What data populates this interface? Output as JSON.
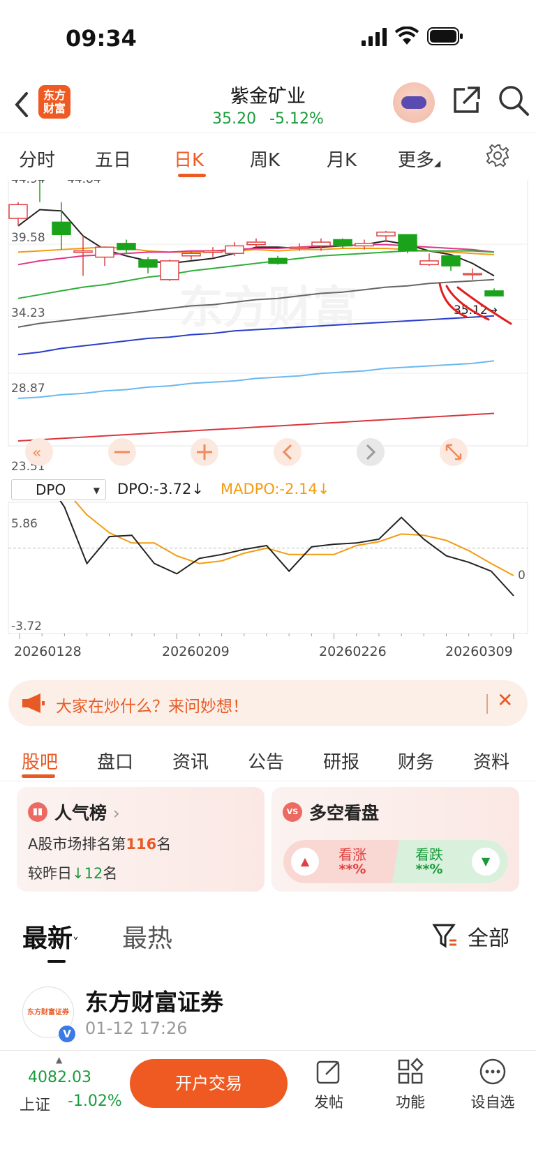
{
  "status": {
    "time": "09:34"
  },
  "header": {
    "logo_text_1": "东方",
    "logo_text_2": "财富",
    "stock_name": "紫金矿业",
    "price": "35.20",
    "change_pct": "-5.12%"
  },
  "tabs": [
    "分时",
    "五日",
    "日K",
    "周K",
    "月K",
    "更多"
  ],
  "active_tab": "日K",
  "kchart": {
    "y_labels": [
      "44.94",
      "44.84",
      "39.58",
      "34.23",
      "28.87",
      "23.51"
    ],
    "price_marker": "35.12→",
    "watermark": "东方财富",
    "toolbar_buttons": [
      "fast-back",
      "zoom-out",
      "zoom-in",
      "prev",
      "next",
      "fullscreen"
    ]
  },
  "indicator": {
    "selected": "DPO",
    "dpo_label": "DPO:-3.72↓",
    "madpo_label": "MADPO:-2.14↓",
    "y_top": "5.86",
    "y_zero": "0",
    "y_bottom": "-3.72",
    "dates": [
      "20260128",
      "20260209",
      "20260226",
      "20260309"
    ]
  },
  "chart_data": [
    {
      "type": "candlestick",
      "title": "",
      "ylim": [
        23.51,
        44.94
      ],
      "candles": [
        {
          "o": 41.2,
          "c": 42.3,
          "h": 42.5,
          "l": 40.6
        },
        {
          "o": 45.1,
          "c": 44.9,
          "h": 45.6,
          "l": 42.5
        },
        {
          "o": 40.9,
          "c": 39.9,
          "h": 42.5,
          "l": 38.7
        },
        {
          "o": 38.6,
          "c": 38.6,
          "h": 39.8,
          "l": 36.6
        },
        {
          "o": 38.1,
          "c": 38.9,
          "h": 38.9,
          "l": 37.4
        },
        {
          "o": 39.2,
          "c": 38.7,
          "h": 39.5,
          "l": 38.4
        },
        {
          "o": 37.9,
          "c": 37.3,
          "h": 38.1,
          "l": 36.8
        },
        {
          "o": 36.3,
          "c": 37.8,
          "h": 37.9,
          "l": 36.2
        },
        {
          "o": 38.2,
          "c": 38.4,
          "h": 38.6,
          "l": 37.9
        },
        {
          "o": 38.5,
          "c": 38.6,
          "h": 38.9,
          "l": 38.1
        },
        {
          "o": 38.4,
          "c": 39.0,
          "h": 39.3,
          "l": 38.2
        },
        {
          "o": 39.1,
          "c": 39.3,
          "h": 39.6,
          "l": 38.9
        },
        {
          "o": 38.0,
          "c": 37.6,
          "h": 38.2,
          "l": 37.5
        },
        {
          "o": 38.9,
          "c": 38.9,
          "h": 39.2,
          "l": 38.6
        },
        {
          "o": 39.0,
          "c": 39.3,
          "h": 39.6,
          "l": 38.6
        },
        {
          "o": 39.5,
          "c": 39.0,
          "h": 39.6,
          "l": 38.8
        },
        {
          "o": 39.0,
          "c": 39.2,
          "h": 39.5,
          "l": 38.7
        },
        {
          "o": 39.8,
          "c": 40.1,
          "h": 40.2,
          "l": 39.3
        },
        {
          "o": 39.9,
          "c": 38.6,
          "h": 39.9,
          "l": 38.4
        },
        {
          "o": 37.5,
          "c": 37.8,
          "h": 38.4,
          "l": 37.4
        },
        {
          "o": 38.2,
          "c": 37.4,
          "h": 38.3,
          "l": 37.0
        },
        {
          "o": 36.7,
          "c": 36.8,
          "h": 37.2,
          "l": 36.3
        },
        {
          "o": 35.4,
          "c": 35.0,
          "h": 35.6,
          "l": 35.0
        }
      ],
      "ma_lines": [
        {
          "name": "MA5",
          "color": "#222222",
          "values": [
            40.6,
            41.9,
            41.8,
            39.8,
            38.7,
            38.2,
            37.8,
            37.6,
            37.8,
            38.0,
            38.4,
            38.9,
            38.9,
            38.8,
            38.9,
            39.0,
            39.1,
            39.4,
            39.1,
            38.6,
            38.3,
            37.6,
            36.6
          ]
        },
        {
          "name": "MA10",
          "color": "#f39c12",
          "values": [
            38.5,
            38.6,
            38.7,
            38.8,
            38.9,
            38.8,
            38.6,
            38.5,
            38.5,
            38.5,
            38.6,
            38.7,
            38.6,
            38.7,
            38.7,
            38.8,
            38.8,
            38.8,
            38.7,
            38.6,
            38.5,
            38.4,
            38.3
          ]
        },
        {
          "name": "MA20",
          "color": "#e0358a",
          "values": [
            37.5,
            37.8,
            38.0,
            38.2,
            38.3,
            38.4,
            38.5,
            38.5,
            38.6,
            38.6,
            38.7,
            38.8,
            38.8,
            38.9,
            39.0,
            39.0,
            39.1,
            39.1,
            39.0,
            38.9,
            38.8,
            38.7,
            38.5
          ]
        },
        {
          "name": "MA30",
          "color": "#2fae3a",
          "values": [
            34.8,
            35.1,
            35.4,
            35.7,
            35.9,
            36.2,
            36.5,
            36.7,
            37.0,
            37.2,
            37.4,
            37.6,
            37.8,
            38.0,
            38.2,
            38.3,
            38.4,
            38.5,
            38.6,
            38.6,
            38.6,
            38.6,
            38.5
          ]
        },
        {
          "name": "MA60",
          "color": "#666666",
          "values": [
            32.5,
            32.8,
            33.0,
            33.2,
            33.4,
            33.6,
            33.8,
            34.0,
            34.2,
            34.3,
            34.5,
            34.7,
            34.8,
            35.0,
            35.2,
            35.3,
            35.5,
            35.7,
            35.8,
            36.0,
            36.1,
            36.2,
            36.3
          ]
        },
        {
          "name": "MA120",
          "color": "#2a3dc9",
          "values": [
            30.3,
            30.5,
            30.8,
            31.0,
            31.2,
            31.4,
            31.6,
            31.7,
            31.9,
            32.0,
            32.2,
            32.3,
            32.4,
            32.5,
            32.6,
            32.7,
            32.8,
            32.9,
            33.0,
            33.1,
            33.2,
            33.3,
            33.4
          ]
        },
        {
          "name": "MA250",
          "color": "#6ab8ef",
          "values": [
            26.8,
            26.9,
            27.1,
            27.2,
            27.4,
            27.5,
            27.7,
            27.8,
            28.0,
            28.1,
            28.2,
            28.4,
            28.5,
            28.6,
            28.8,
            28.9,
            29.0,
            29.2,
            29.3,
            29.4,
            29.5,
            29.6,
            29.8
          ]
        },
        {
          "name": "MA500",
          "color": "#d9363e",
          "values": [
            23.4,
            23.5,
            23.6,
            23.7,
            23.8,
            23.9,
            24.0,
            24.1,
            24.2,
            24.3,
            24.4,
            24.5,
            24.6,
            24.7,
            24.8,
            24.9,
            25.0,
            25.1,
            25.2,
            25.3,
            25.4,
            25.5,
            25.6
          ]
        }
      ]
    },
    {
      "type": "line",
      "title": "",
      "ylim": [
        -3.72,
        5.86
      ],
      "x": [
        "20260128",
        "",
        "",
        "",
        "",
        "",
        "",
        "20260209",
        "",
        "",
        "",
        "",
        "",
        "",
        "20260226",
        "",
        "",
        "",
        "",
        "",
        "",
        "",
        "20260309"
      ],
      "series": [
        {
          "name": "DPO",
          "color": "#222222",
          "values": [
            4.8,
            5.86,
            3.2,
            -1.2,
            0.9,
            1.0,
            -1.2,
            -2.0,
            -0.8,
            -0.5,
            -0.1,
            0.2,
            -1.8,
            0.1,
            0.3,
            0.4,
            0.7,
            2.4,
            0.7,
            -0.6,
            -1.1,
            -1.8,
            -3.72
          ]
        },
        {
          "name": "MADPO",
          "color": "#f39c12",
          "values": [
            3.8,
            4.8,
            4.6,
            2.6,
            1.2,
            0.4,
            0.4,
            -0.6,
            -1.2,
            -1.0,
            -0.4,
            0.0,
            -0.5,
            -0.5,
            -0.5,
            0.2,
            0.5,
            1.1,
            1.0,
            0.6,
            -0.2,
            -1.2,
            -2.14
          ]
        }
      ]
    }
  ],
  "banner": {
    "text": "大家在炒什么？来问妙想！",
    "close": "✕"
  },
  "subtabs": [
    "股吧",
    "盘口",
    "资讯",
    "公告",
    "研报",
    "财务",
    "资料"
  ],
  "popularity": {
    "title": "人气榜",
    "chevron": "›",
    "rank_prefix": "A股市场排名第",
    "rank": "116",
    "rank_suffix": "名",
    "change_prefix": "较昨日",
    "change_value": "12",
    "change_suffix": "名"
  },
  "long_short": {
    "badge": "VS",
    "title": "多空看盘",
    "up_label": "看涨",
    "up_pct": "**%",
    "down_label": "看跌",
    "down_pct": "**%"
  },
  "feed": {
    "latest": "最新",
    "hot": "最热",
    "all": "全部"
  },
  "post": {
    "avatar_text": "东方财富证券",
    "author": "东方财富证券",
    "time": "01-12 17:26",
    "verified": "V"
  },
  "bottom": {
    "index_value": "4082.03",
    "index_name": "上证",
    "index_change": "-1.02%",
    "trade_button": "开户交易",
    "post_label": "发帖",
    "func_label": "功能",
    "fav_label": "设自选"
  },
  "colors": {
    "accent": "#ef5a22",
    "down": "#1a9b3b",
    "up": "#e04040"
  }
}
